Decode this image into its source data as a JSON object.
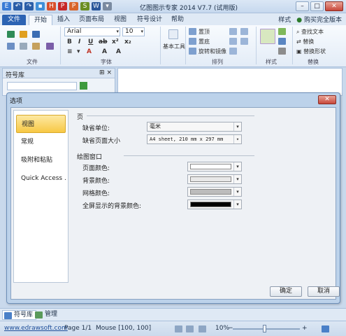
{
  "window": {
    "title": "亿图图示专家 2014 V7.7 (试用版)",
    "controls": [
      "–",
      "□",
      "✕"
    ]
  },
  "qat": {
    "icons": [
      {
        "name": "app-logo-icon",
        "glyph": "E",
        "color": "#3a7bd5"
      },
      {
        "name": "undo-icon",
        "glyph": "↶",
        "color": "#2b5ea8"
      },
      {
        "name": "redo-icon",
        "glyph": "↷",
        "color": "#2b5ea8"
      },
      {
        "name": "new-icon",
        "glyph": "▪",
        "color": "#3f8fd8"
      },
      {
        "name": "html-export-icon",
        "glyph": "H",
        "color": "#d94f2b"
      },
      {
        "name": "pdf-export-icon",
        "glyph": "P",
        "color": "#c62828"
      },
      {
        "name": "ppt-export-icon",
        "glyph": "P",
        "color": "#d9652b"
      },
      {
        "name": "svg-export-icon",
        "glyph": "S",
        "color": "#6b8e23"
      },
      {
        "name": "word-export-icon",
        "glyph": "W",
        "color": "#2b579a"
      },
      {
        "name": "more-icon",
        "glyph": "▾",
        "color": "#7a8aa0"
      }
    ]
  },
  "ribbon": {
    "tabs": [
      "文件",
      "开始",
      "插入",
      "页面布局",
      "视图",
      "符号设计",
      "帮助"
    ],
    "right": {
      "style": "样式",
      "buy": "购买完全版本"
    },
    "groups": {
      "file": "文件",
      "font": "字体",
      "basic_tools": "基本工具",
      "arrange": "排列",
      "style": "样式",
      "replace": "替换"
    },
    "font_name": "Arial",
    "font_size": "10",
    "arrange_items": [
      "置顶",
      "置底",
      "旋转和镜像"
    ],
    "replace_items": [
      "查找文本",
      "替换",
      "替换形状"
    ]
  },
  "symbol_panel": {
    "title": "符号库",
    "pin": "⊞ ×"
  },
  "dialog": {
    "title": "选项",
    "close": "✕",
    "nav": [
      "视图",
      "常规",
      "吸附和粘贴",
      "Quick Access ..."
    ],
    "selected_nav": 0,
    "page_section": "页",
    "unit_label": "缺省单位:",
    "unit_value": "毫米",
    "pagesize_label": "缺省页面大小",
    "pagesize_value": "A4 sheet, 210 mm x 297 mm",
    "drawing_section": "绘图窗口",
    "colors": [
      {
        "label": "页面颜色:",
        "value": "#ffffff"
      },
      {
        "label": "背景颜色:",
        "value": "#e8e8e8"
      },
      {
        "label": "网格颜色:",
        "value": "#bcbcbc"
      },
      {
        "label": "全屏显示的背景颜色:",
        "value": "#000000"
      }
    ],
    "ok": "确定",
    "cancel": "取消"
  },
  "panel_tabs": [
    "符号库",
    "管理"
  ],
  "status": {
    "website": "www.edrawsoft.com",
    "page": "Page 1/1",
    "mouse": "Mouse [100, 100]",
    "zoom": "10%"
  }
}
